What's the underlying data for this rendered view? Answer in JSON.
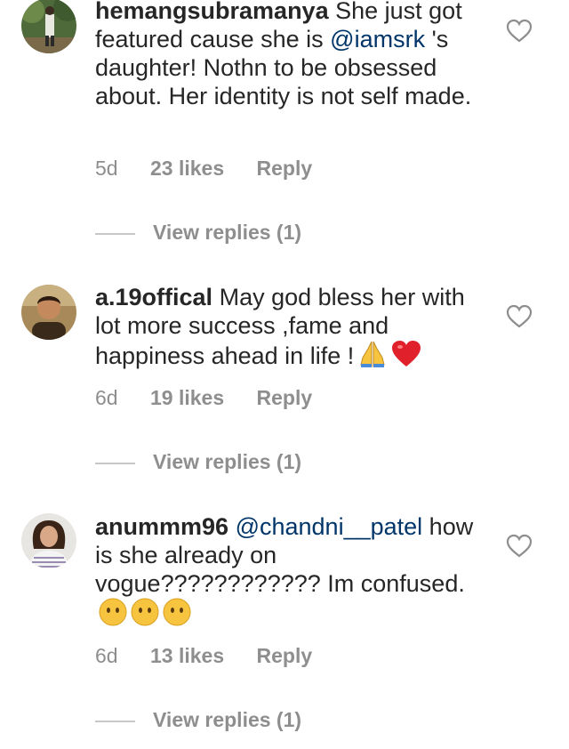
{
  "comments": [
    {
      "username": "hemangsubramanya",
      "text_before": "She just got featured cause she is ",
      "mention": "@iamsrk",
      "text_after": " 's daughter! Nothn to be obsessed about. Her identity is not self made.",
      "time": "5d",
      "likes": "23 likes",
      "reply": "Reply",
      "view_replies": "View replies (1)",
      "like_icon": "heart-outline-icon"
    },
    {
      "username": "a.19offical",
      "text": "May god bless her with lot more success ,fame and happiness ahead in life !",
      "emojis": [
        "folded-hands-emoji",
        "red-heart-emoji"
      ],
      "time": "6d",
      "likes": "19 likes",
      "reply": "Reply",
      "view_replies": "View replies (1)",
      "like_icon": "heart-outline-icon"
    },
    {
      "username": "anummm96",
      "mention": "@chandni__patel",
      "text": "how is she already on vogue???????????? Im confused.",
      "emojis": [
        "no-mouth-face-emoji",
        "no-mouth-face-emoji",
        "no-mouth-face-emoji"
      ],
      "time": "6d",
      "likes": "13 likes",
      "reply": "Reply",
      "view_replies": "View replies (1)",
      "like_icon": "heart-outline-icon"
    }
  ],
  "colors": {
    "text": "#262626",
    "secondary": "#8e8e8e",
    "mention": "#003569",
    "divider": "#c7c7c7"
  }
}
